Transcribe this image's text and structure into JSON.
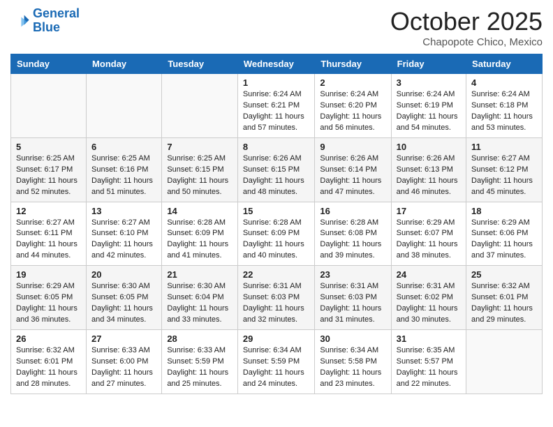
{
  "header": {
    "logo_line1": "General",
    "logo_line2": "Blue",
    "month": "October 2025",
    "location": "Chapopote Chico, Mexico"
  },
  "weekdays": [
    "Sunday",
    "Monday",
    "Tuesday",
    "Wednesday",
    "Thursday",
    "Friday",
    "Saturday"
  ],
  "weeks": [
    [
      {
        "day": "",
        "content": ""
      },
      {
        "day": "",
        "content": ""
      },
      {
        "day": "",
        "content": ""
      },
      {
        "day": "1",
        "content": "Sunrise: 6:24 AM\nSunset: 6:21 PM\nDaylight: 11 hours and 57 minutes."
      },
      {
        "day": "2",
        "content": "Sunrise: 6:24 AM\nSunset: 6:20 PM\nDaylight: 11 hours and 56 minutes."
      },
      {
        "day": "3",
        "content": "Sunrise: 6:24 AM\nSunset: 6:19 PM\nDaylight: 11 hours and 54 minutes."
      },
      {
        "day": "4",
        "content": "Sunrise: 6:24 AM\nSunset: 6:18 PM\nDaylight: 11 hours and 53 minutes."
      }
    ],
    [
      {
        "day": "5",
        "content": "Sunrise: 6:25 AM\nSunset: 6:17 PM\nDaylight: 11 hours and 52 minutes."
      },
      {
        "day": "6",
        "content": "Sunrise: 6:25 AM\nSunset: 6:16 PM\nDaylight: 11 hours and 51 minutes."
      },
      {
        "day": "7",
        "content": "Sunrise: 6:25 AM\nSunset: 6:15 PM\nDaylight: 11 hours and 50 minutes."
      },
      {
        "day": "8",
        "content": "Sunrise: 6:26 AM\nSunset: 6:15 PM\nDaylight: 11 hours and 48 minutes."
      },
      {
        "day": "9",
        "content": "Sunrise: 6:26 AM\nSunset: 6:14 PM\nDaylight: 11 hours and 47 minutes."
      },
      {
        "day": "10",
        "content": "Sunrise: 6:26 AM\nSunset: 6:13 PM\nDaylight: 11 hours and 46 minutes."
      },
      {
        "day": "11",
        "content": "Sunrise: 6:27 AM\nSunset: 6:12 PM\nDaylight: 11 hours and 45 minutes."
      }
    ],
    [
      {
        "day": "12",
        "content": "Sunrise: 6:27 AM\nSunset: 6:11 PM\nDaylight: 11 hours and 44 minutes."
      },
      {
        "day": "13",
        "content": "Sunrise: 6:27 AM\nSunset: 6:10 PM\nDaylight: 11 hours and 42 minutes."
      },
      {
        "day": "14",
        "content": "Sunrise: 6:28 AM\nSunset: 6:09 PM\nDaylight: 11 hours and 41 minutes."
      },
      {
        "day": "15",
        "content": "Sunrise: 6:28 AM\nSunset: 6:09 PM\nDaylight: 11 hours and 40 minutes."
      },
      {
        "day": "16",
        "content": "Sunrise: 6:28 AM\nSunset: 6:08 PM\nDaylight: 11 hours and 39 minutes."
      },
      {
        "day": "17",
        "content": "Sunrise: 6:29 AM\nSunset: 6:07 PM\nDaylight: 11 hours and 38 minutes."
      },
      {
        "day": "18",
        "content": "Sunrise: 6:29 AM\nSunset: 6:06 PM\nDaylight: 11 hours and 37 minutes."
      }
    ],
    [
      {
        "day": "19",
        "content": "Sunrise: 6:29 AM\nSunset: 6:05 PM\nDaylight: 11 hours and 36 minutes."
      },
      {
        "day": "20",
        "content": "Sunrise: 6:30 AM\nSunset: 6:05 PM\nDaylight: 11 hours and 34 minutes."
      },
      {
        "day": "21",
        "content": "Sunrise: 6:30 AM\nSunset: 6:04 PM\nDaylight: 11 hours and 33 minutes."
      },
      {
        "day": "22",
        "content": "Sunrise: 6:31 AM\nSunset: 6:03 PM\nDaylight: 11 hours and 32 minutes."
      },
      {
        "day": "23",
        "content": "Sunrise: 6:31 AM\nSunset: 6:03 PM\nDaylight: 11 hours and 31 minutes."
      },
      {
        "day": "24",
        "content": "Sunrise: 6:31 AM\nSunset: 6:02 PM\nDaylight: 11 hours and 30 minutes."
      },
      {
        "day": "25",
        "content": "Sunrise: 6:32 AM\nSunset: 6:01 PM\nDaylight: 11 hours and 29 minutes."
      }
    ],
    [
      {
        "day": "26",
        "content": "Sunrise: 6:32 AM\nSunset: 6:01 PM\nDaylight: 11 hours and 28 minutes."
      },
      {
        "day": "27",
        "content": "Sunrise: 6:33 AM\nSunset: 6:00 PM\nDaylight: 11 hours and 27 minutes."
      },
      {
        "day": "28",
        "content": "Sunrise: 6:33 AM\nSunset: 5:59 PM\nDaylight: 11 hours and 25 minutes."
      },
      {
        "day": "29",
        "content": "Sunrise: 6:34 AM\nSunset: 5:59 PM\nDaylight: 11 hours and 24 minutes."
      },
      {
        "day": "30",
        "content": "Sunrise: 6:34 AM\nSunset: 5:58 PM\nDaylight: 11 hours and 23 minutes."
      },
      {
        "day": "31",
        "content": "Sunrise: 6:35 AM\nSunset: 5:57 PM\nDaylight: 11 hours and 22 minutes."
      },
      {
        "day": "",
        "content": ""
      }
    ]
  ]
}
